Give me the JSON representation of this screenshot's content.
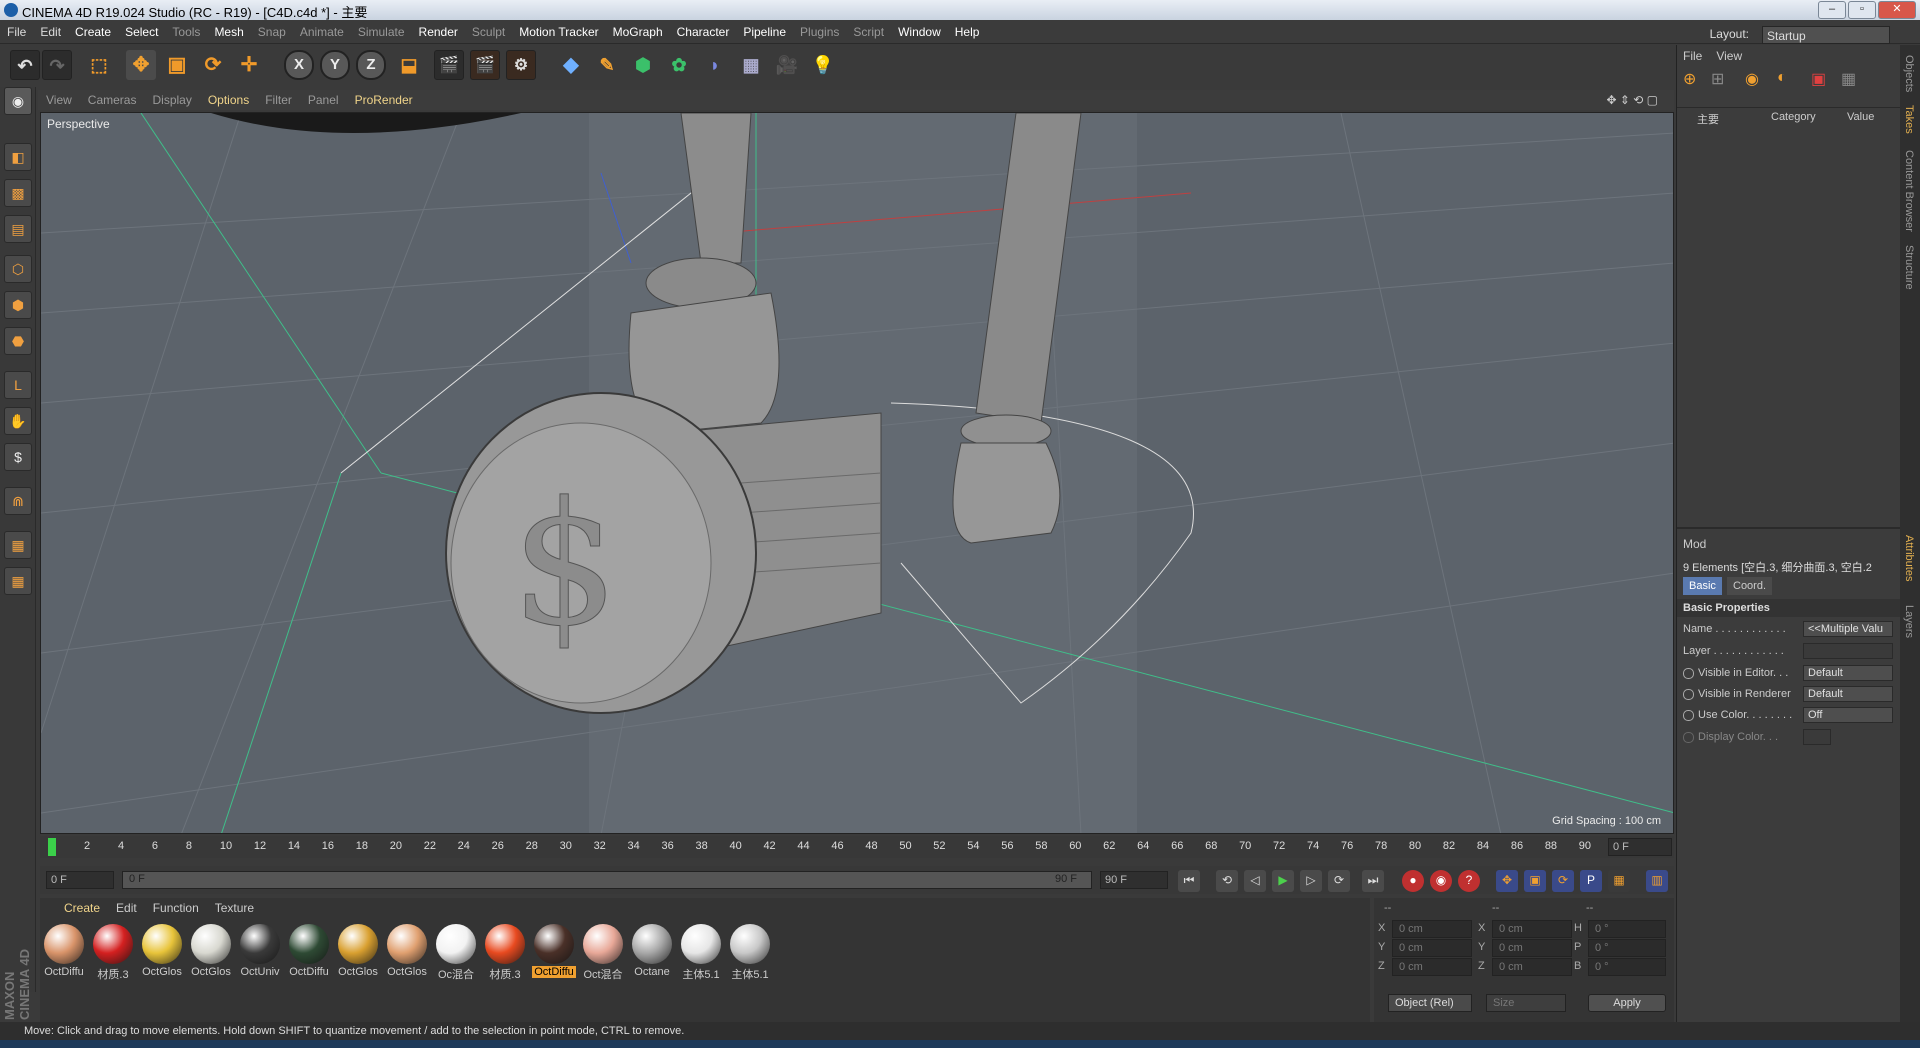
{
  "window": {
    "title": "CINEMA 4D R19.024 Studio (RC - R19) - [C4D.c4d *] - 主要"
  },
  "menu": {
    "items": [
      "File",
      "Edit",
      "Create",
      "Select",
      "Tools",
      "Mesh",
      "Snap",
      "Animate",
      "Simulate",
      "Render",
      "Sculpt",
      "Motion Tracker",
      "MoGraph",
      "Character",
      "Pipeline",
      "Plugins",
      "Script",
      "Window",
      "Help"
    ]
  },
  "layout": {
    "label": "Layout:",
    "value": "Startup"
  },
  "viewport": {
    "menu": [
      "View",
      "Cameras",
      "Display",
      "Options",
      "Filter",
      "Panel",
      "ProRender"
    ],
    "label": "Perspective",
    "grid_spacing": "Grid Spacing : 100 cm"
  },
  "timeline": {
    "ticks": [
      "0",
      "2",
      "4",
      "6",
      "8",
      "10",
      "12",
      "14",
      "16",
      "18",
      "20",
      "22",
      "24",
      "26",
      "28",
      "30",
      "32",
      "34",
      "36",
      "38",
      "40",
      "42",
      "44",
      "46",
      "48",
      "50",
      "52",
      "54",
      "56",
      "58",
      "60",
      "62",
      "64",
      "66",
      "68",
      "70",
      "72",
      "74",
      "76",
      "78",
      "80",
      "82",
      "84",
      "86",
      "88",
      "90"
    ],
    "current_frame": "0 F",
    "start_field": "0 F",
    "range_start": "0 F",
    "range_end": "90 F",
    "end_field": "90 F"
  },
  "materials": {
    "menu": [
      "Create",
      "Edit",
      "Function",
      "Texture"
    ],
    "items": [
      {
        "label": "OctDiffu",
        "color": "#d9946a"
      },
      {
        "label": "材质.3",
        "color": "#d42020"
      },
      {
        "label": "OctGlos",
        "color": "#e8c43a"
      },
      {
        "label": "OctGlos",
        "color": "#d8d8d0"
      },
      {
        "label": "OctUniv",
        "color": "#3a3a3a"
      },
      {
        "label": "OctDiffu",
        "color": "#2e4a34"
      },
      {
        "label": "OctGlos",
        "color": "#d9a030"
      },
      {
        "label": "OctGlos",
        "color": "#e0a070"
      },
      {
        "label": "Oc混合",
        "color": "#f2f2f2"
      },
      {
        "label": "材质.3",
        "color": "#e84a20"
      },
      {
        "label": "OctDiffu",
        "color": "#4a3028"
      },
      {
        "label": "Oct混合",
        "color": "#e8a898"
      },
      {
        "label": "Octane",
        "color": "#a8a8a8"
      },
      {
        "label": "主体5.1",
        "color": "#e6e6e6"
      },
      {
        "label": "主体5.1",
        "color": "#c8c8c8"
      }
    ],
    "selected_index": 10
  },
  "coords": {
    "headers": [
      "--",
      "--",
      "--"
    ],
    "rows": [
      {
        "a": "X",
        "av": "0 cm",
        "b": "X",
        "bv": "0 cm",
        "c": "H",
        "cv": "0 °"
      },
      {
        "a": "Y",
        "av": "0 cm",
        "b": "Y",
        "bv": "0 cm",
        "c": "P",
        "cv": "0 °"
      },
      {
        "a": "Z",
        "av": "0 cm",
        "b": "Z",
        "bv": "0 cm",
        "c": "B",
        "cv": "0 °"
      }
    ],
    "mode": "Object (Rel)",
    "size_mode": "Size",
    "apply": "Apply"
  },
  "status": "Move: Click and drag to move elements. Hold down SHIFT to quantize movement / add to the selection in point mode, CTRL to remove.",
  "objects_panel": {
    "menu": [
      "File",
      "View"
    ],
    "columns": [
      "主要",
      "Category",
      "Value"
    ]
  },
  "attributes": {
    "mode": "Mod",
    "selection": "9 Elements [空白.3, 细分曲面.3, 空白.2",
    "tabs": [
      "Basic",
      "Coord."
    ],
    "section": "Basic Properties",
    "rows": [
      {
        "label": "Name . . . . . . . . . . . .",
        "value": "<<Multiple Valu"
      },
      {
        "label": "Layer . . . . . . . . . . . .",
        "value": ""
      },
      {
        "label": "Visible in Editor. . .",
        "value": "Default"
      },
      {
        "label": "Visible in Renderer",
        "value": "Default"
      },
      {
        "label": "Use Color. . . . . . . .",
        "value": "Off"
      },
      {
        "label": "Display Color. . .",
        "value": ""
      }
    ]
  },
  "side_tabs": [
    "Objects",
    "Takes",
    "Content Browser",
    "Structure",
    "Attributes",
    "Layers"
  ],
  "logo": "MAXON CINEMA 4D"
}
